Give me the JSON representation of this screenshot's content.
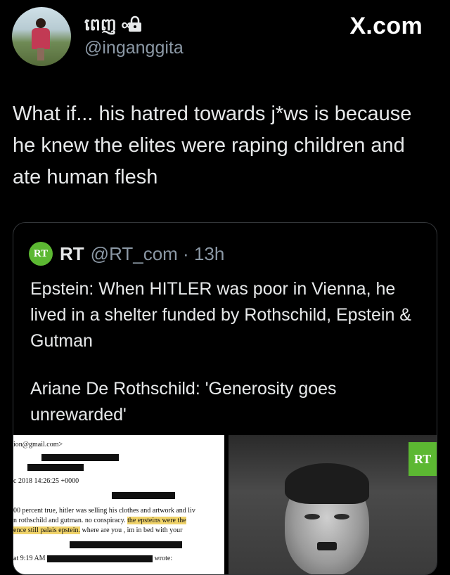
{
  "header": {
    "display_name": "ពេញ ∞",
    "handle": "@inganggita",
    "site": "X.com"
  },
  "tweet": {
    "text": "What if... his hatred towards j*ws is because he knew the elites were raping children and ate human flesh"
  },
  "quote": {
    "logo": "RT",
    "name": "RT",
    "meta": "@RT_com · 13h",
    "text1": "Epstein: When HITLER was poor in Vienna, he lived in a shelter funded by Rothschild, Epstein & Gutman",
    "text2": "Ariane De Rothschild: 'Generosity goes unrewarded'",
    "doc": {
      "email": "ion@gmail.com>",
      "date": "c 2018 14:26:25 +0000",
      "line1": "00 percent true,   hitler was selling his clothes and artwork and liv",
      "line2a": "n rothschild and gutman.   no conspiracy.  ",
      "line2b": "the epsteins  were the",
      "line3a": "ence still palais epstein.",
      "line3b": "   where are you ,     im in bed with your",
      "time": "at 9:19 AM",
      "wrote": "wrote:"
    },
    "photo_badge": "RT"
  },
  "colors": {
    "background": "#000000",
    "muted": "#8b98a5",
    "rt_green": "#5cb832"
  }
}
